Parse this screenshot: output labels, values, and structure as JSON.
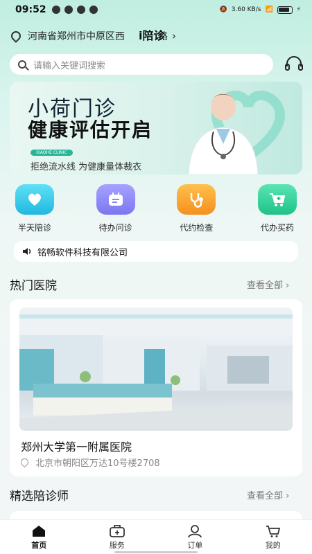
{
  "status": {
    "time": "09:52",
    "net_speed": "3.60 KB/s"
  },
  "header": {
    "location": "河南省郑州市中原区西",
    "location_tail": "路",
    "overlay_title": "i陪诊",
    "search_placeholder": "请输入关键词搜索"
  },
  "banner": {
    "title1": "小荷门诊",
    "title2": "健康评估开启",
    "tag": "XIAOHE CLINIC",
    "subtitle": "拒绝流水线 为健康量体裁衣"
  },
  "quick": [
    {
      "label": "半天陪诊",
      "color": "#3ccfe8",
      "icon": "heart-hands-icon"
    },
    {
      "label": "待办问诊",
      "color": "#8a86f5",
      "icon": "calendar-icon"
    },
    {
      "label": "代约检查",
      "color": "#f7a23a",
      "icon": "stethoscope-icon"
    },
    {
      "label": "代办买药",
      "color": "#36d39c",
      "icon": "cart-icon"
    }
  ],
  "notice": "铭畅软件科技有限公司",
  "hot_hospitals": {
    "title": "热门医院",
    "see_all": "查看全部",
    "items": [
      {
        "name": "郑州大学第一附属医院",
        "address": "北京市朝阳区万达10号楼2708"
      }
    ]
  },
  "escorts": {
    "title": "精选陪诊师",
    "see_all": "查看全部"
  },
  "tabs": [
    {
      "label": "首页",
      "icon": "home-icon",
      "active": true
    },
    {
      "label": "服务",
      "icon": "medkit-icon",
      "active": false
    },
    {
      "label": "订单",
      "icon": "user-icon",
      "active": false
    },
    {
      "label": "我的",
      "icon": "cart-icon",
      "active": false
    }
  ]
}
